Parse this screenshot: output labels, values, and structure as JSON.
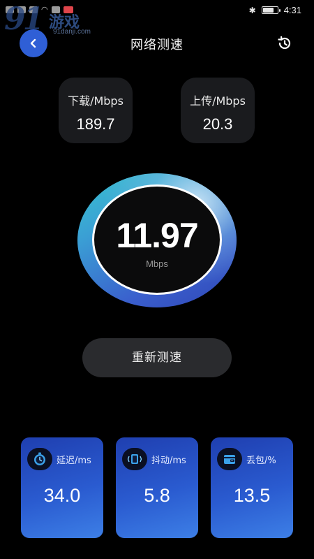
{
  "status_bar": {
    "time": "4:31",
    "battery_level": 0.8
  },
  "watermark": {
    "logo_number": "91",
    "logo_text": "游戏",
    "url": "91danji.com"
  },
  "header": {
    "title": "网络测速",
    "back_icon": "chevron-left-icon",
    "history_icon": "history-icon"
  },
  "stats": {
    "download": {
      "label": "下载/Mbps",
      "value": "189.7"
    },
    "upload": {
      "label": "上传/Mbps",
      "value": "20.3"
    }
  },
  "gauge": {
    "value": "11.97",
    "unit": "Mbps"
  },
  "retest_button": {
    "label": "重新测速"
  },
  "metrics": {
    "latency": {
      "label": "延迟/ms",
      "value": "34.0",
      "icon": "clock-icon"
    },
    "jitter": {
      "label": "抖动/ms",
      "value": "5.8",
      "icon": "jitter-icon"
    },
    "packet_loss": {
      "label": "丢包/%",
      "value": "13.5",
      "icon": "wallet-icon"
    }
  },
  "colors": {
    "accent_blue": "#2f5fd6",
    "gauge_teal": "#38c4cf",
    "card_dark": "#1a1b1e"
  }
}
